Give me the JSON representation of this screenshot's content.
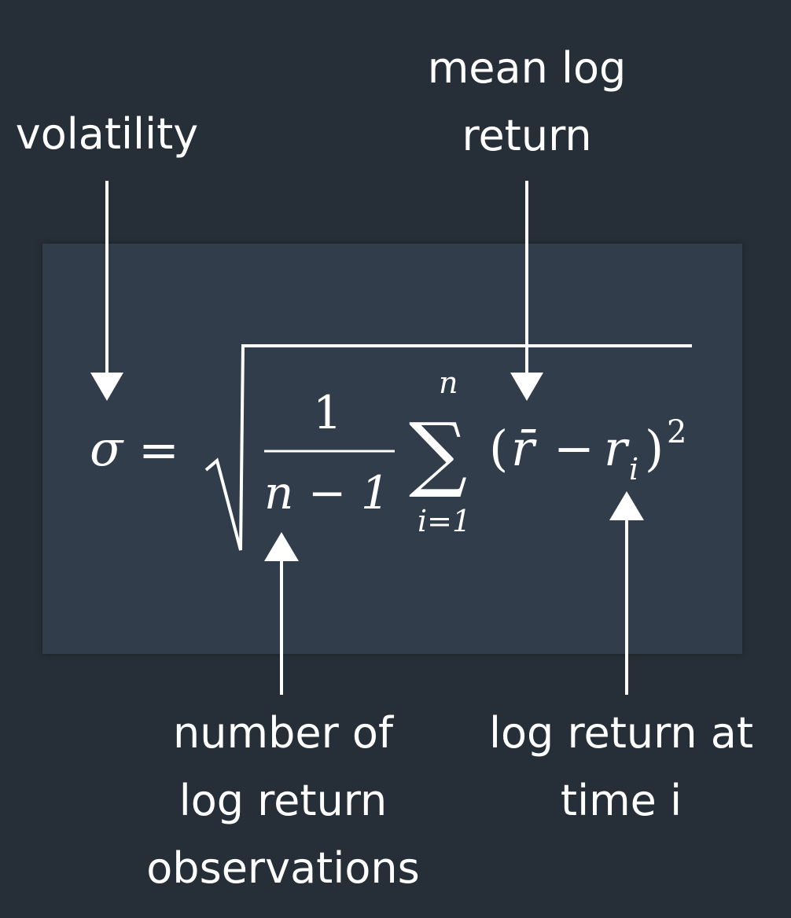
{
  "labels": {
    "volatility": "volatility",
    "mean_log_return": [
      "mean log",
      "return"
    ],
    "number_of_observations": [
      "number of",
      "log return",
      "observations"
    ],
    "log_return_at_time_i": [
      "log return at",
      "time i"
    ]
  },
  "formula": {
    "sigma": "σ",
    "equals": "=",
    "numerator": "1",
    "denominator": "n − 1",
    "sum_symbol": "∑",
    "sum_upper": "n",
    "sum_lower": "i=1",
    "open_paren": "(",
    "r_bar": "r̄",
    "minus": "−",
    "r": "r",
    "subscript_i": "i",
    "close_paren": ")",
    "exponent": "2"
  },
  "colors": {
    "background": "#262f38",
    "formula_box": "#313d4b",
    "foreground": "#ffffff"
  }
}
